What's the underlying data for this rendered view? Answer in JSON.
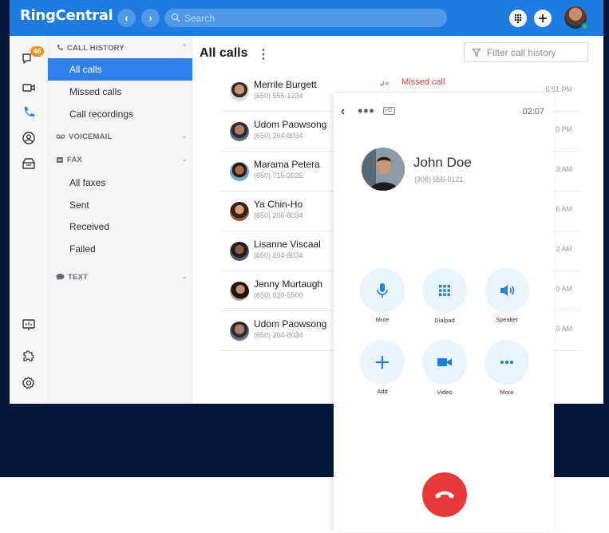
{
  "app": {
    "brand": "RingCentral",
    "search_placeholder": "Search",
    "messages_badge": "46"
  },
  "sidebar": {
    "call_history": {
      "heading": "CALL HISTORY",
      "items": [
        {
          "label": "All calls",
          "active": true
        },
        {
          "label": "Missed calls"
        },
        {
          "label": "Call recordings"
        }
      ]
    },
    "voicemail": {
      "heading": "VOICEMAIL"
    },
    "fax": {
      "heading": "FAX",
      "items": [
        {
          "label": "All faxes"
        },
        {
          "label": "Sent"
        },
        {
          "label": "Received"
        },
        {
          "label": "Failed"
        }
      ]
    },
    "text": {
      "heading": "TEXT"
    }
  },
  "main": {
    "title": "All calls",
    "filter_placeholder": "Filter call history",
    "calls": [
      {
        "name": "Merrile Burgett",
        "phone": "(650) 555-1234",
        "status": "Missed call",
        "time": "5:51 PM"
      },
      {
        "name": "Udom Paowsong",
        "phone": "(650) 204-8034",
        "time": "0 PM"
      },
      {
        "name": "Marama Petera",
        "phone": "(650) 715-2025",
        "time": "3 AM"
      },
      {
        "name": "Ya Chin-Ho",
        "phone": "(650) 206-8034",
        "time": "6 AM"
      },
      {
        "name": "Lisanne Viscaal",
        "phone": "(650) 204-8034",
        "time": "2 AM"
      },
      {
        "name": "Jenny Murtaugh",
        "phone": "(650) 520-5500",
        "time": "0 AM"
      },
      {
        "name": "Udom Paowsong",
        "phone": "(650) 204-8034",
        "time": "0 AM"
      }
    ]
  },
  "call": {
    "hd": "HD",
    "timer": "02:07",
    "caller_name": "John Doe",
    "caller_number": "(308) 555-0121",
    "controls": {
      "mute": "Mute",
      "dialpad": "Dialpad",
      "speaker": "Speaker",
      "add": "Add",
      "video": "Video",
      "more": "More"
    }
  },
  "colors": {
    "topbar": "#1e7be0",
    "accent": "#2f80ea",
    "missed": "#e3413b",
    "end_call": "#e8383c",
    "backdrop": "#06163a"
  }
}
